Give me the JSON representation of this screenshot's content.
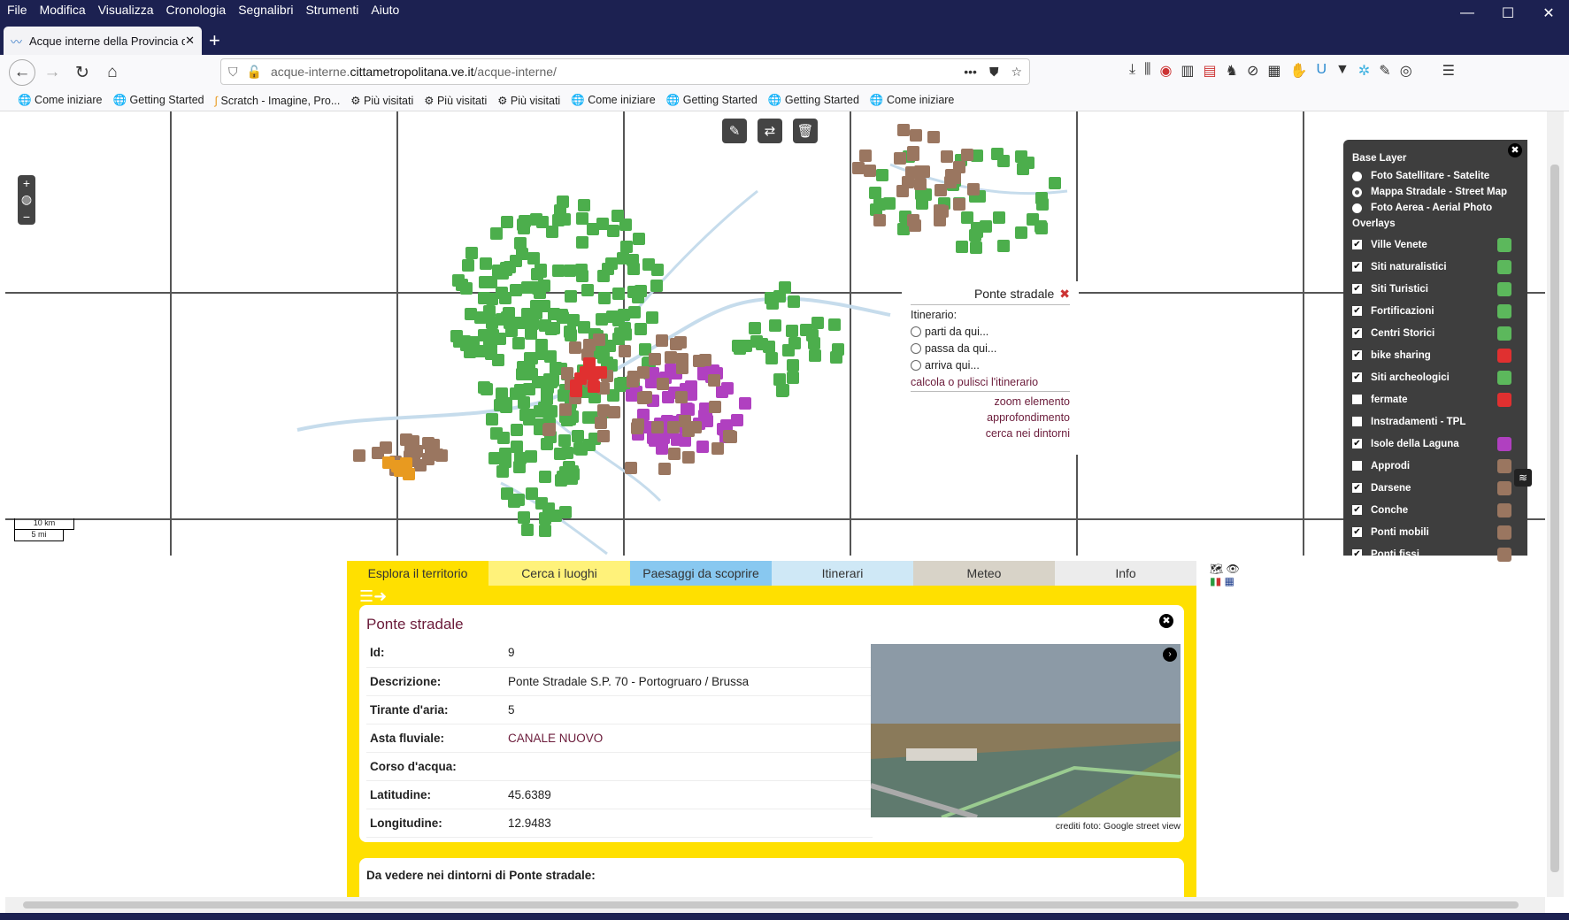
{
  "menu": [
    "File",
    "Modifica",
    "Visualizza",
    "Cronologia",
    "Segnalibri",
    "Strumenti",
    "Aiuto"
  ],
  "tab": {
    "title": "Acque interne della Provincia d"
  },
  "url": {
    "pre": "acque-interne.",
    "host": "cittametropolitana.ve.it",
    "path": "/acque-interne/"
  },
  "bookmarks": [
    "Come iniziare",
    "Getting Started",
    "Scratch - Imagine, Pro...",
    "Più visitati",
    "Più visitati",
    "Più visitati",
    "Come iniziare",
    "Getting Started",
    "Getting Started",
    "Come iniziare"
  ],
  "popup": {
    "title": "Ponte stradale",
    "itinerario": "Itinerario:",
    "options": [
      "parti da qui...",
      "passa da qui...",
      "arriva qui..."
    ],
    "calc": "calcola o pulisci l'itinerario",
    "links": [
      "zoom elemento",
      "approfondimento",
      "cerca nei dintorni"
    ]
  },
  "scale": {
    "km": "10 km",
    "mi": "5 mi"
  },
  "layers": {
    "base_title": "Base Layer",
    "base": [
      "Foto Satellitare - Satelite",
      "Mappa Stradale - Street Map",
      "Foto Aerea - Aerial Photo"
    ],
    "overlays_title": "Overlays",
    "overlays": [
      {
        "label": "Ville Venete",
        "checked": true,
        "color": "#5cb85c"
      },
      {
        "label": "Siti naturalistici",
        "checked": true,
        "color": "#5cb85c"
      },
      {
        "label": "Siti Turistici",
        "checked": true,
        "color": "#5cb85c"
      },
      {
        "label": "Fortificazioni",
        "checked": true,
        "color": "#5cb85c"
      },
      {
        "label": "Centri Storici",
        "checked": true,
        "color": "#5cb85c"
      },
      {
        "label": "bike sharing",
        "checked": true,
        "color": "#e03030"
      },
      {
        "label": "Siti archeologici",
        "checked": true,
        "color": "#5cb85c"
      },
      {
        "label": "fermate",
        "checked": false,
        "color": "#e03030"
      },
      {
        "label": "Instradamenti - TPL",
        "checked": false,
        "color": ""
      },
      {
        "label": "Isole della Laguna",
        "checked": true,
        "color": "#b040c0"
      },
      {
        "label": "Approdi",
        "checked": false,
        "color": "#9a7660"
      },
      {
        "label": "Darsene",
        "checked": true,
        "color": "#9a7660"
      },
      {
        "label": "Conche",
        "checked": true,
        "color": "#9a7660"
      },
      {
        "label": "Ponti mobili",
        "checked": true,
        "color": "#9a7660"
      },
      {
        "label": "Ponti fissi",
        "checked": true,
        "color": "#9a7660"
      }
    ]
  },
  "tabs": [
    {
      "label": "Esplora il territorio",
      "bg": "#ffe000"
    },
    {
      "label": "Cerca i luoghi",
      "bg": "#fff27a"
    },
    {
      "label": "Paesaggi da scoprire",
      "bg": "#88c8f0"
    },
    {
      "label": "Itinerari",
      "bg": "#cfe8f6"
    },
    {
      "label": "Meteo",
      "bg": "#d8d3c8"
    },
    {
      "label": "Info",
      "bg": "#ececec"
    }
  ],
  "detail": {
    "title": "Ponte stradale",
    "rows": [
      {
        "k": "Id:",
        "v": "9"
      },
      {
        "k": "Descrizione:",
        "v": "Ponte Stradale S.P. 70 - Portogruaro / Brussa"
      },
      {
        "k": "Tirante d'aria:",
        "v": "5"
      },
      {
        "k": "Asta fluviale:",
        "v": "CANALE NUOVO"
      },
      {
        "k": "Corso d'acqua:",
        "v": ""
      },
      {
        "k": "Latitudine:",
        "v": "45.6389"
      },
      {
        "k": "Longitudine:",
        "v": "12.9483"
      }
    ],
    "credits": "crediti foto: Google street view"
  },
  "nearby": "Da vedere nei dintorni di Ponte stradale:"
}
